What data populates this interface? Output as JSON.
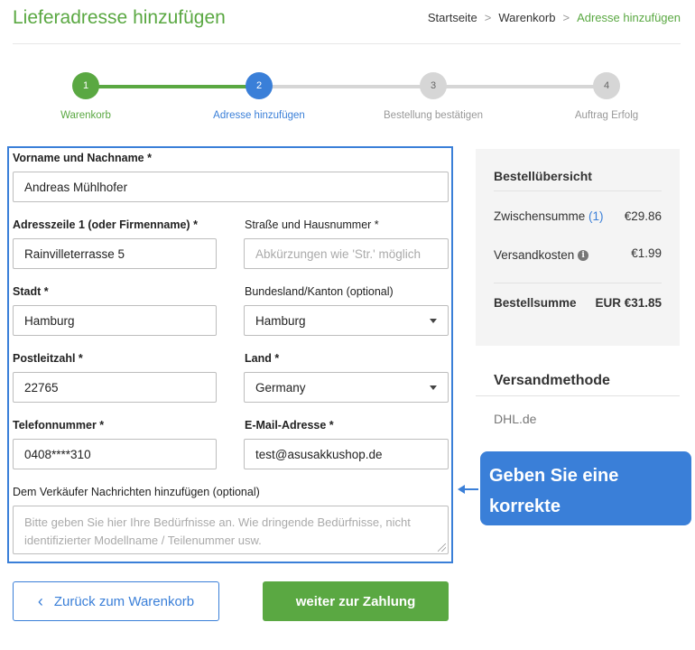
{
  "header": {
    "title": "Lieferadresse hinzufügen",
    "breadcrumb": [
      "Startseite",
      "Warenkorb",
      "Adresse hinzufügen"
    ],
    "separator": ">"
  },
  "steps": [
    {
      "number": "1",
      "label": "Warenkorb",
      "state": "done"
    },
    {
      "number": "2",
      "label": "Adresse hinzufügen",
      "state": "current"
    },
    {
      "number": "3",
      "label": "Bestellung bestätigen",
      "state": "todo"
    },
    {
      "number": "4",
      "label": "Auftrag Erfolg",
      "state": "todo"
    }
  ],
  "form": {
    "name": {
      "label": "Vorname und Nachname *",
      "value": "Andreas Mühlhofer"
    },
    "address1": {
      "label": "Adresszeile 1 (oder Firmenname) *",
      "value": "Rainvilleterrasse 5"
    },
    "street": {
      "label": "Straße und Hausnummer *",
      "placeholder": "Abkürzungen wie 'Str.' möglich"
    },
    "city": {
      "label": "Stadt *",
      "value": "Hamburg"
    },
    "state": {
      "label": "Bundesland/Kanton (optional)",
      "value": "Hamburg"
    },
    "zip": {
      "label": "Postleitzahl *",
      "value": "22765"
    },
    "country": {
      "label": "Land *",
      "value": "Germany"
    },
    "phone": {
      "label": "Telefonnummer *",
      "value": "0408****310"
    },
    "email": {
      "label": "E-Mail-Adresse *",
      "value": "test@asusakkushop.de"
    },
    "message": {
      "label": "Dem Verkäufer Nachrichten hinzufügen (optional)",
      "placeholder": "Bitte geben Sie hier Ihre Bedürfnisse an. Wie dringende Bedürfnisse, nicht identifizierter Modellname / Teilenummer usw."
    }
  },
  "summary": {
    "title": "Bestellübersicht",
    "subtotal_label": "Zwischensumme",
    "subtotal_count": "(1)",
    "subtotal_value": "€29.86",
    "shipping_label": "Versandkosten",
    "shipping_value": "€1.99",
    "total_label": "Bestellsumme",
    "total_value": "EUR €31.85"
  },
  "shipping": {
    "title": "Versandmethode",
    "method": "DHL.de"
  },
  "callout": {
    "line1": "Geben Sie eine",
    "line2": "korrekte Lieferadresse"
  },
  "buttons": {
    "back_icon": "‹",
    "back": "Zurück zum Warenkorb",
    "next": "weiter zur Zahlung"
  },
  "colors": {
    "green": "#5aa842",
    "blue": "#3a7fd8",
    "grey": "#d6d6d6"
  },
  "icons": {
    "info": "info-icon",
    "dropdown": "caret-down-icon",
    "back": "chevron-left-icon",
    "callout_arrow": "arrow-left-icon"
  }
}
